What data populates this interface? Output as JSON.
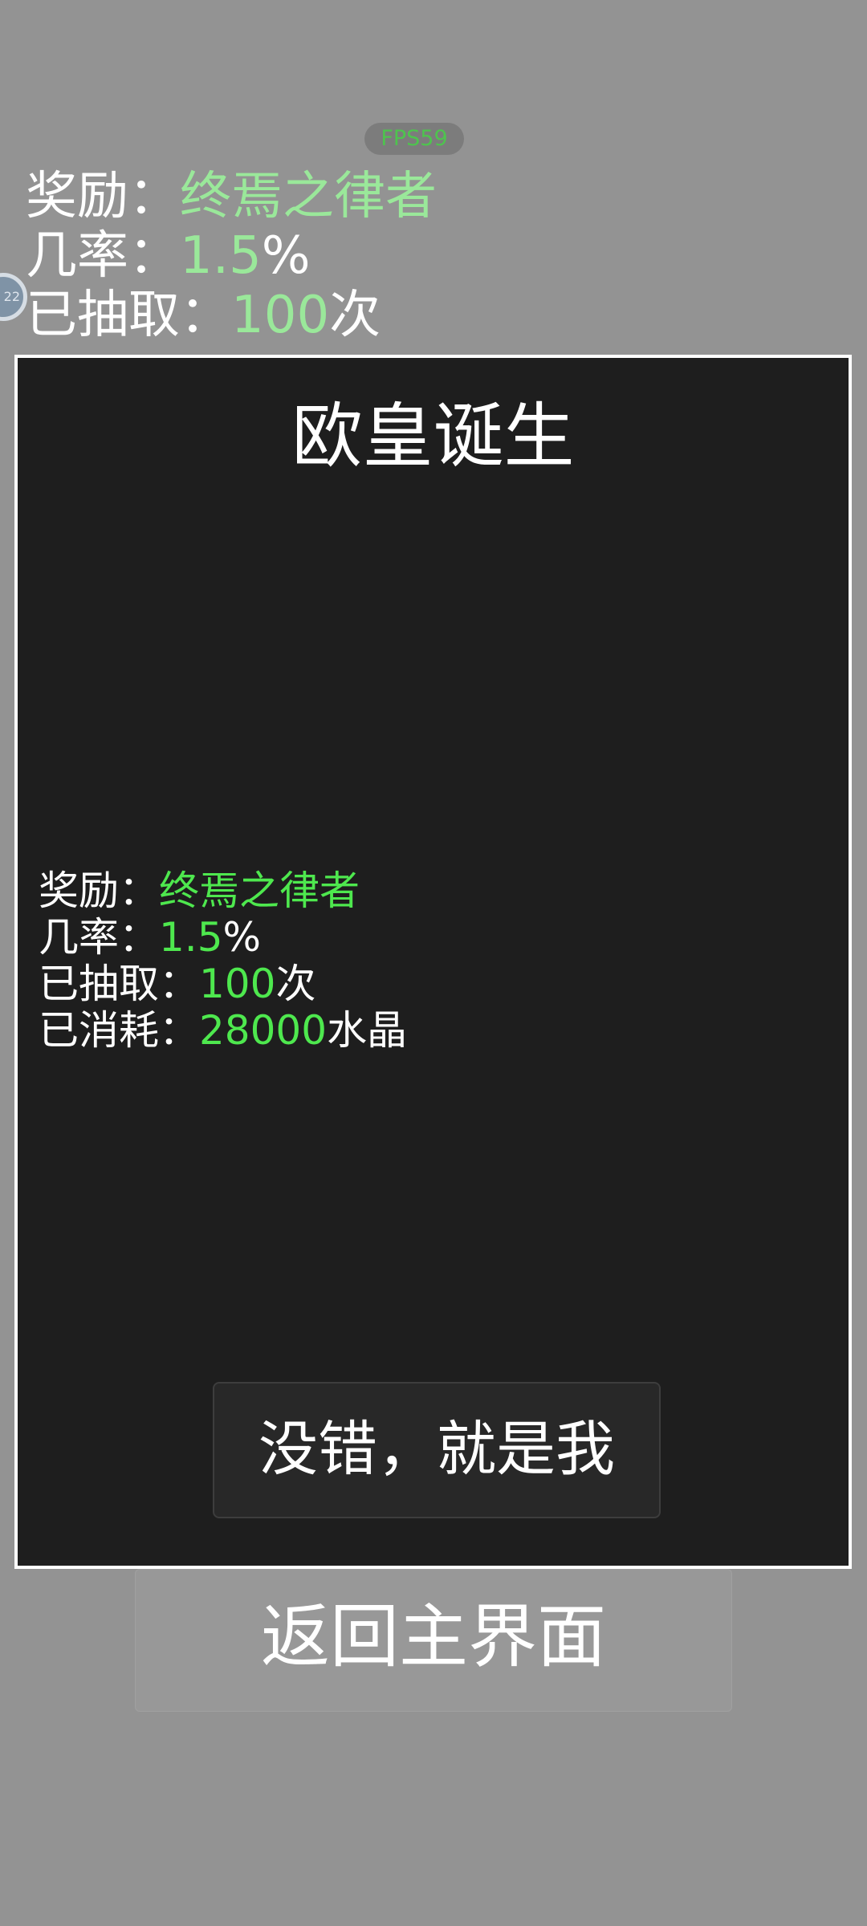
{
  "fps": "FPS59",
  "side_knob_text": "22",
  "background_stats": {
    "reward_label": "奖励：",
    "reward_value": "终焉之律者",
    "chance_label": "几率：",
    "chance_value": "1.5",
    "chance_unit": "%",
    "draws_label": "已抽取：",
    "draws_value": "100",
    "draws_unit": "次"
  },
  "return_button_label": "返回主界面",
  "modal": {
    "title": "欧皇诞生",
    "stats": {
      "reward_label": "奖励：",
      "reward_value": "终焉之律者",
      "chance_label": "几率：",
      "chance_value": "1.5",
      "chance_unit": "%",
      "draws_label": "已抽取：",
      "draws_value": "100",
      "draws_unit": "次",
      "spent_label": "已消耗：",
      "spent_value": "28000",
      "spent_unit": "水晶"
    },
    "confirm_label": "没错，就是我"
  },
  "colors": {
    "background": "#939393",
    "modal_background": "#1e1e1e",
    "highlight_green": "#4ee84e",
    "background_highlight": "#9ae89a"
  }
}
